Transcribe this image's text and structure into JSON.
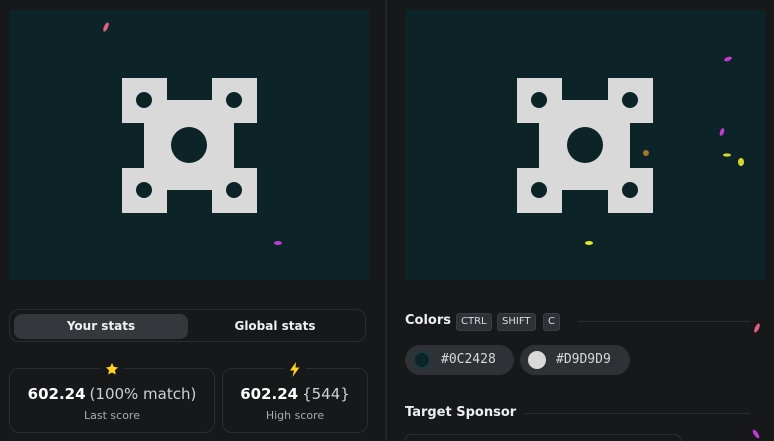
{
  "tabs": {
    "your_stats": "Your stats",
    "global_stats": "Global stats"
  },
  "stats": {
    "last_score": {
      "value": "602.24",
      "extra": "(100% match)",
      "label": "Last score",
      "icon": "star-icon"
    },
    "high_score": {
      "value": "602.24",
      "extra": "{544}",
      "label": "High score",
      "icon": "lightning-icon"
    }
  },
  "colors_section": {
    "title": "Colors",
    "shortcut_keys": [
      "CTRL",
      "SHIFT",
      "C"
    ],
    "swatches": [
      {
        "hex": "#0C2428",
        "label": "#0C2428"
      },
      {
        "hex": "#D9D9D9",
        "label": "#D9D9D9"
      }
    ]
  },
  "sponsor_section": {
    "title": "Target Sponsor"
  },
  "palette": {
    "canvas_bg": "#0C2428",
    "shape_fill": "#D9D9D9",
    "app_bg": "#17181a",
    "star": "#ffd21f",
    "lightning": "#ffd21f"
  }
}
